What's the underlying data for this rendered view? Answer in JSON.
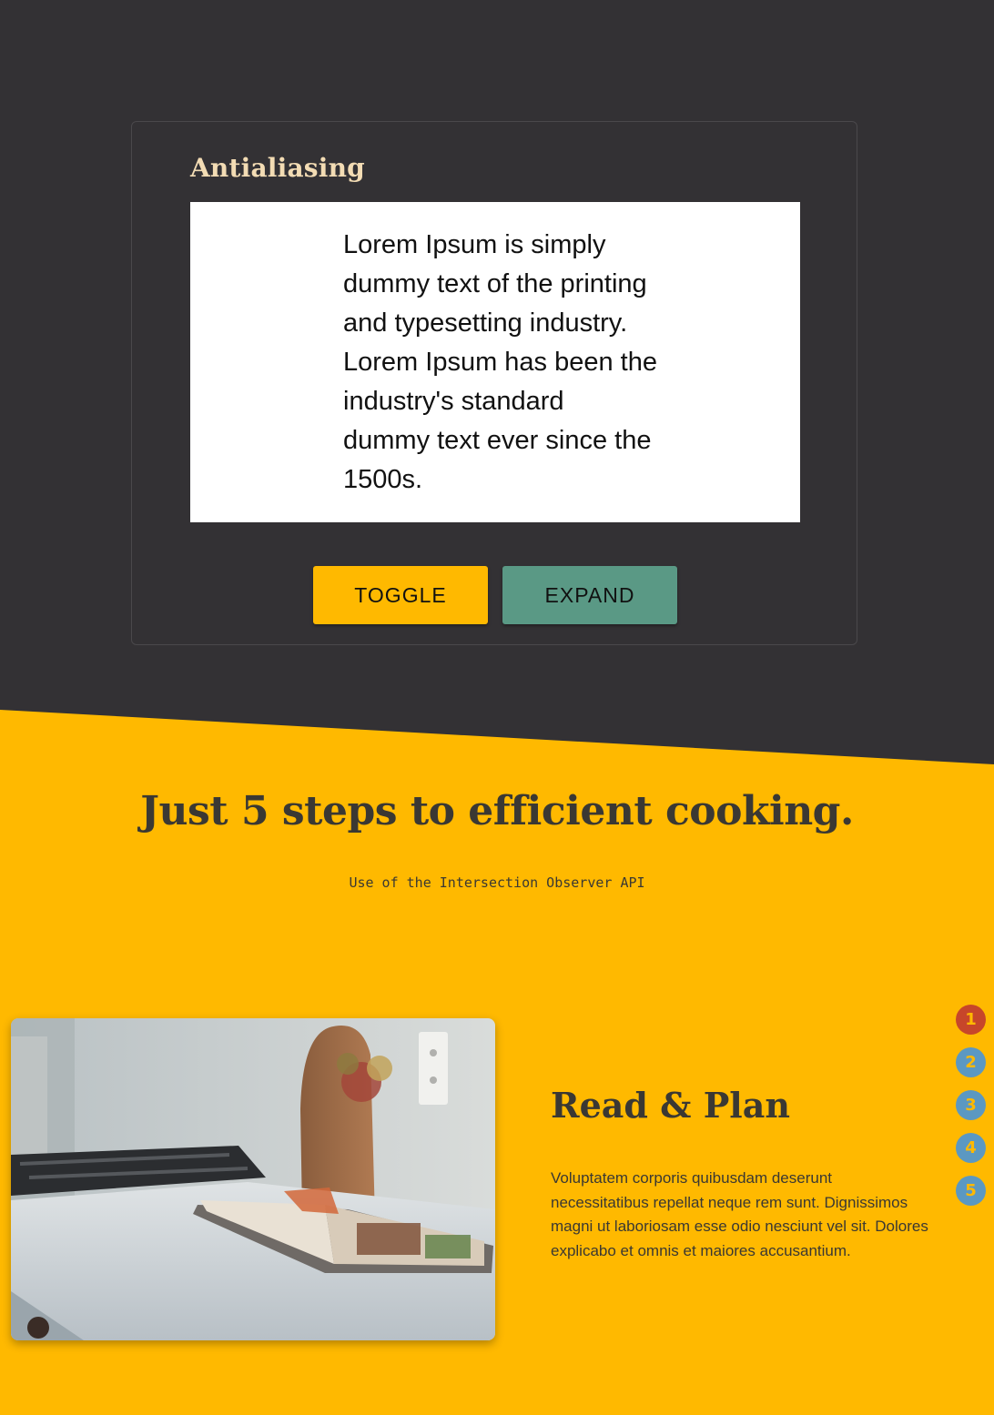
{
  "antialiasing_card": {
    "title": "Antialiasing",
    "sample_text": "Lorem Ipsum is simply dummy text of the printing and typesetting industry. Lorem Ipsum has been the industry's standard dummy text ever since the 1500s.",
    "toggle_label": "TOGGLE",
    "expand_label": "EXPAND"
  },
  "steps_section": {
    "title": "Just 5 steps to efficient cooking.",
    "subtitle": "Use of the Intersection Observer API",
    "current_step": {
      "title": "Read & Plan",
      "description": "Voluptatem corporis quibusdam deserunt necessitatibus repellat neque rem sunt. Dignissimos magni ut laboriosam esse odio nesciunt vel sit. Dolores explicabo et omnis et maiores accusantium.",
      "image_icon": "cookbook-on-counter-photo"
    },
    "stepper": [
      "1",
      "2",
      "3",
      "4",
      "5"
    ],
    "active_step": "1"
  },
  "colors": {
    "dark_bg": "#333134",
    "accent_yellow": "#ffb900",
    "teal": "#5a9985",
    "active_dot": "#c7462a",
    "inactive_dot": "#5b98c2",
    "title_cream": "#f3dcb4"
  }
}
